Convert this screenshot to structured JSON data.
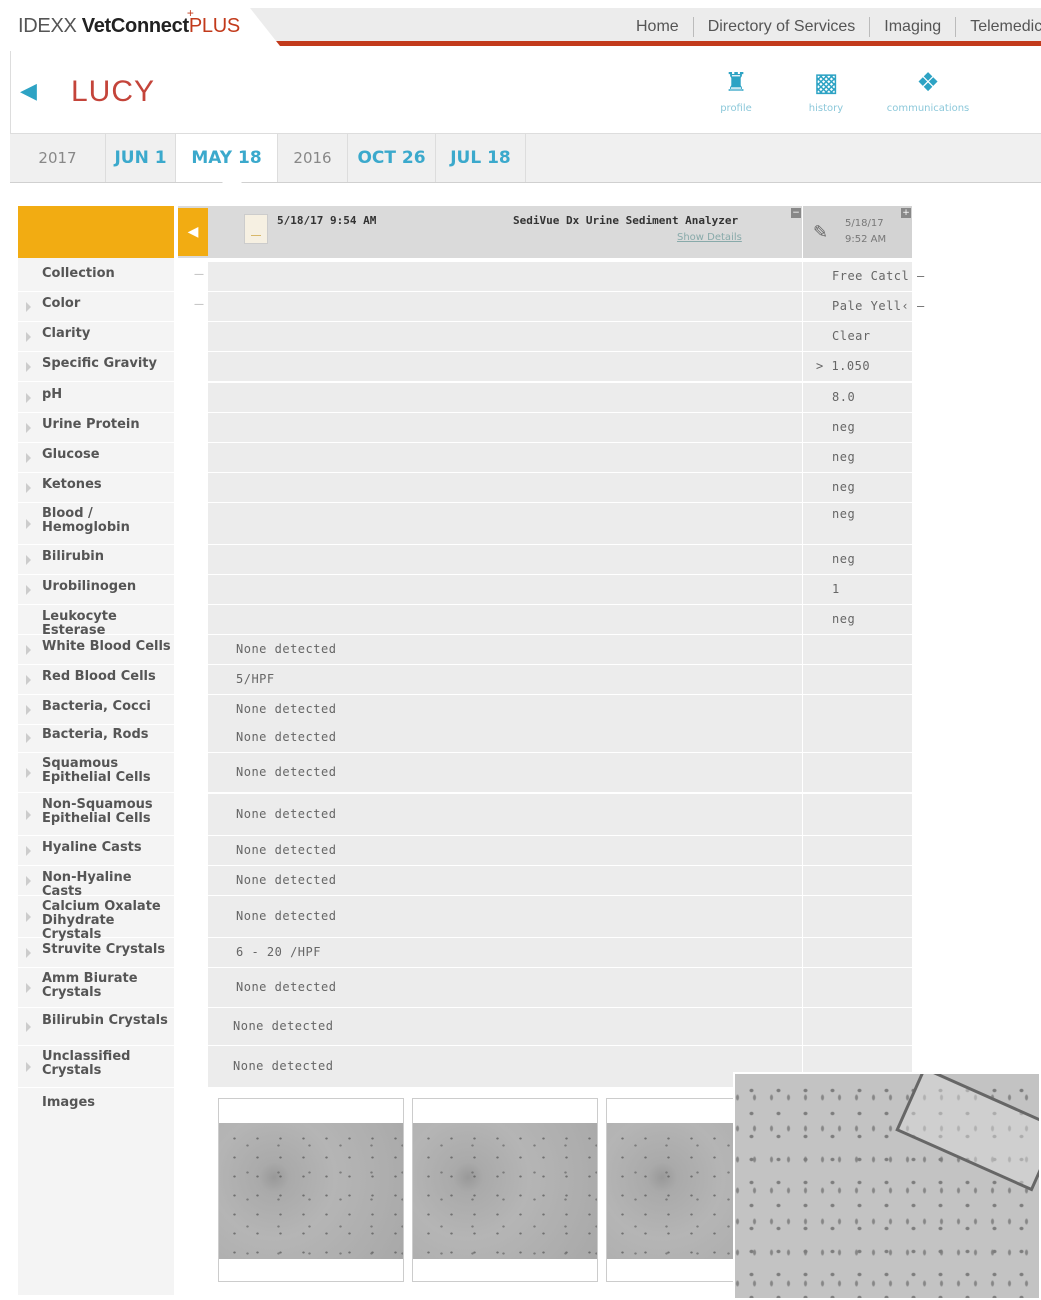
{
  "header": {
    "logo_idexx": "IDEXX",
    "logo_vetconnect": "VetConnect",
    "logo_plus": "PLUS",
    "nav": [
      "Home",
      "Directory of Services",
      "Imaging",
      "Telemedicine"
    ]
  },
  "patient": {
    "name": "LUCY",
    "icons": [
      {
        "icon": "dog-icon",
        "label": "profile"
      },
      {
        "icon": "folder-icon",
        "label": "history"
      },
      {
        "icon": "chat-bubbles-icon",
        "label": "communications"
      }
    ]
  },
  "dates": [
    {
      "text": "2017",
      "kind": "year"
    },
    {
      "text": "JUN 1",
      "kind": "date"
    },
    {
      "text": "MAY 18",
      "kind": "date",
      "selected": true
    },
    {
      "text": "2016",
      "kind": "year"
    },
    {
      "text": "OCT 26",
      "kind": "date"
    },
    {
      "text": "JUL 18",
      "kind": "date"
    }
  ],
  "result_header": {
    "datetime": "5/18/17 9:54 AM",
    "analyzer": "SediVue Dx Urine Sediment Analyzer",
    "show_details": "Show Details",
    "collapse": "−",
    "expand": "+",
    "second_date": "5/18/17",
    "second_time": "9:52 AM"
  },
  "rows": [
    {
      "label": "Collection",
      "sub": "",
      "r1": "",
      "r2": "Free Catcl —",
      "dash": "—",
      "arrow": false
    },
    {
      "label": "Color",
      "sub": "",
      "r1": "",
      "r2": "Pale Yell‹ —",
      "dash": "—",
      "arrow": true
    },
    {
      "label": "Clarity",
      "sub": "",
      "r1": "",
      "r2": "Clear",
      "arrow": true
    },
    {
      "label": "Specific Gravity",
      "sub": "",
      "r1": "",
      "r2": "> 1.050",
      "arrow": true
    },
    {
      "label": "pH",
      "sub": "",
      "r1": "",
      "r2": "8.0",
      "arrow": true
    },
    {
      "label": "Urine Protein",
      "sub": "",
      "r1": "",
      "r2": "neg",
      "arrow": true
    },
    {
      "label": "Glucose",
      "sub": "",
      "r1": "",
      "r2": "neg",
      "arrow": true
    },
    {
      "label": "Ketones",
      "sub": "",
      "r1": "",
      "r2": "neg",
      "arrow": true
    },
    {
      "label": "Blood /",
      "sub": "Hemoglobin",
      "r1": "",
      "r2": "neg",
      "arrow": true
    },
    {
      "label": "Bilirubin",
      "sub": "",
      "r1": "",
      "r2": "neg",
      "arrow": true
    },
    {
      "label": "Urobilinogen",
      "sub": "",
      "r1": "",
      "r2": "1",
      "arrow": true
    },
    {
      "label": "Leukocyte Esterase",
      "sub": "",
      "r1": "",
      "r2": "neg",
      "arrow": false
    },
    {
      "label": "White Blood Cells",
      "sub": "",
      "r1": "None detected",
      "r2": "",
      "arrow": true
    },
    {
      "label": "Red Blood Cells",
      "sub": "",
      "r1": "5/HPF",
      "r2": "",
      "arrow": true
    },
    {
      "label": "Bacteria, Cocci",
      "sub": "",
      "r1": "None detected",
      "r2": "",
      "arrow": true
    },
    {
      "label": "Bacteria, Rods",
      "sub": "",
      "r1": "None detected",
      "r2": "",
      "arrow": true
    },
    {
      "label": "Squamous",
      "sub": "Epithelial Cells",
      "r1": "None detected",
      "r2": "",
      "arrow": true
    },
    {
      "label": "Non-Squamous",
      "sub": "Epithelial Cells",
      "r1": "None detected",
      "r2": "",
      "arrow": true
    },
    {
      "label": "Hyaline Casts",
      "sub": "",
      "r1": "None detected",
      "r2": "",
      "arrow": true
    },
    {
      "label": "Non-Hyaline Casts",
      "sub": "",
      "r1": "None detected",
      "r2": "",
      "arrow": true
    },
    {
      "label": "Calcium Oxalate",
      "sub": "Dihydrate Crystals",
      "r1": "None detected",
      "r2": "",
      "arrow": true
    },
    {
      "label": "Struvite Crystals",
      "sub": "",
      "r1": "6 - 20 /HPF",
      "r2": "",
      "arrow": true
    },
    {
      "label": "Amm Biurate",
      "sub": "Crystals",
      "r1": "None detected",
      "r2": "",
      "arrow": true
    },
    {
      "label": "Bilirubin Crystals",
      "sub": "",
      "r1": "None detected",
      "r2": "",
      "arrow": true
    },
    {
      "label": "Unclassified",
      "sub": "Crystals",
      "r1": "None detected",
      "r2": "",
      "arrow": true
    },
    {
      "label": "Images",
      "sub": "",
      "r1": "",
      "r2": "",
      "arrow": false
    }
  ]
}
